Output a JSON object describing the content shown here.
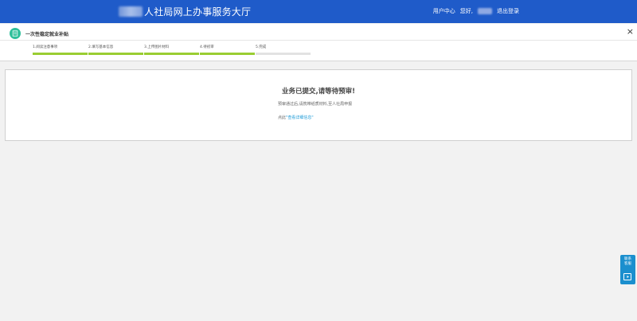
{
  "header": {
    "title": "人社局网上办事服务大厅",
    "user_center": "用户中心",
    "greeting": "您好,",
    "logout": "退出登录"
  },
  "panel": {
    "icon": "form-icon",
    "title": "一次性稳定就业补贴",
    "close_label": "×"
  },
  "steps": [
    {
      "label": "1.阅读注意事项",
      "done": true
    },
    {
      "label": "2.填写基本信息",
      "done": true
    },
    {
      "label": "3.上传图片材料",
      "done": true
    },
    {
      "label": "4.待初审",
      "done": true
    },
    {
      "label": "5.完成",
      "done": false
    }
  ],
  "message": {
    "heading": "业务已提交,请等待预审!",
    "sub": "预审通过后,请携带纸质材料,至人社局申报",
    "link_prefix": "点此",
    "link_text": "\"查看详细信息\""
  },
  "side_widget": {
    "line1": "联系",
    "line2": "客服",
    "icon": "play-icon"
  },
  "colors": {
    "header_bg": "#1f5bc9",
    "step_done": "#9acd32",
    "step_todo": "#e2e2e2",
    "link": "#1e9bd7",
    "side_widget": "#1b8fce",
    "panel_icon": "#2ebf9a"
  }
}
